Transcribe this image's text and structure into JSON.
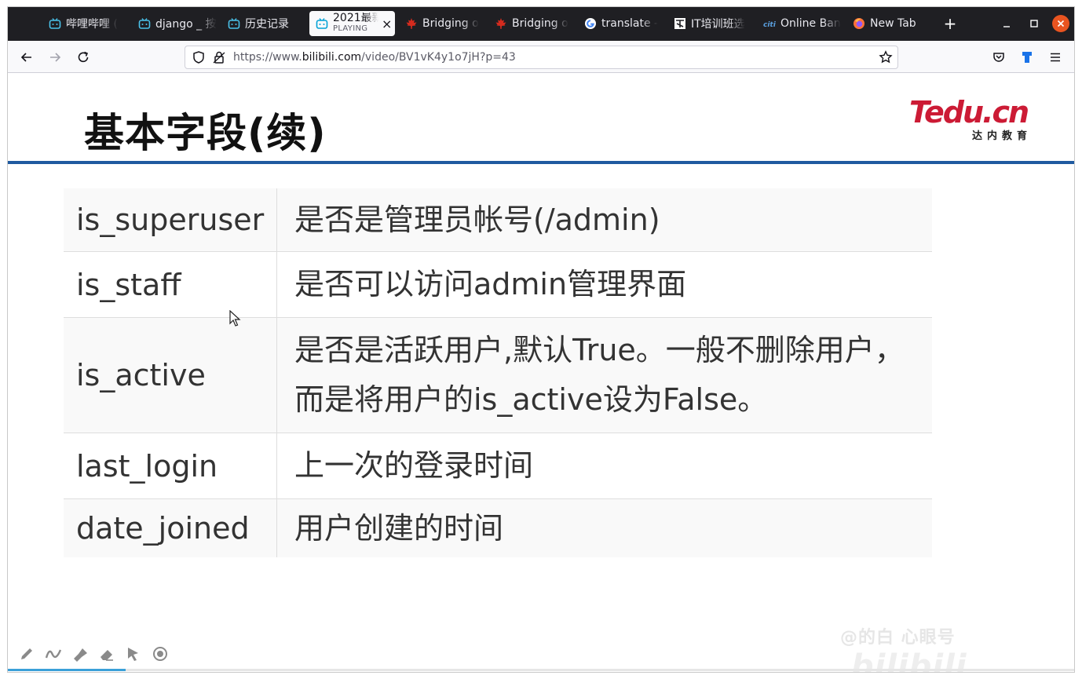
{
  "browser": {
    "tabs": [
      {
        "label": "哔哩哔哩 (",
        "icon": "bilibili-icon",
        "active": false
      },
      {
        "label": "django _ 按",
        "icon": "bilibili-icon",
        "active": false
      },
      {
        "label": "历史记录",
        "icon": "bilibili-icon",
        "active": false
      },
      {
        "label": "2021最新",
        "sublabel": "PLAYING",
        "icon": "bilibili-icon",
        "active": true
      },
      {
        "label": "Bridging o",
        "icon": "maple-leaf-icon",
        "active": false
      },
      {
        "label": "Bridging o",
        "icon": "maple-leaf-icon",
        "active": false
      },
      {
        "label": "translate -",
        "icon": "google-icon",
        "active": false
      },
      {
        "label": "IT培训班选",
        "icon": "site-icon",
        "active": false
      },
      {
        "label": "Online Ban",
        "icon": "bank-icon",
        "active": false
      },
      {
        "label": "New Tab",
        "icon": "firefox-icon",
        "active": false
      }
    ],
    "url_prefix": "https://www.",
    "url_domain": "bilibili.com",
    "url_path": "/video/BV1vK4y1o7jH?p=43",
    "new_tab_symbol": "+",
    "close_tab_symbol": "×"
  },
  "slide": {
    "title": "基本字段(续)",
    "logo_main": "Tedu.cn",
    "logo_sub": "达内教育",
    "rows": [
      {
        "key": "is_superuser",
        "value": "是否是管理员帐号(/admin)"
      },
      {
        "key": "is_staff",
        "value": "是否可以访问admin管理界面"
      },
      {
        "key": "is_active",
        "value": "是否是活跃用户,默认True。一般不删除用户，而是将用户的is_active设为False。"
      },
      {
        "key": "last_login",
        "value": "上一次的登录时间"
      },
      {
        "key": "date_joined",
        "value": "用户创建的时间"
      }
    ]
  },
  "player": {
    "progress": 0.11,
    "watermark_text": "@的白 心眼号",
    "watermark_brand": "bilibili"
  },
  "colors": {
    "accent_rule": "#1f5aa0",
    "logo_red": "#cc1b35",
    "tab_bar": "#1f1f23",
    "close_button": "#e95420"
  }
}
